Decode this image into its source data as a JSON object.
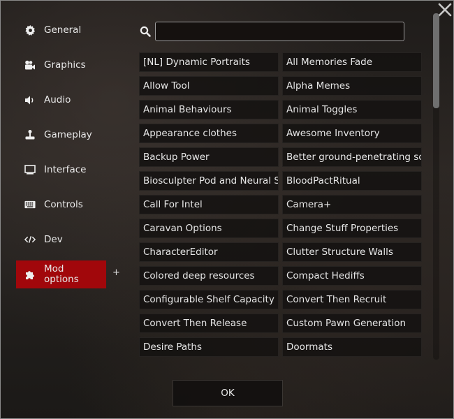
{
  "sidebar": {
    "items": [
      {
        "label": "General",
        "icon": "gear-icon"
      },
      {
        "label": "Graphics",
        "icon": "video-camera-icon"
      },
      {
        "label": "Audio",
        "icon": "speaker-icon"
      },
      {
        "label": "Gameplay",
        "icon": "joystick-icon"
      },
      {
        "label": "Interface",
        "icon": "monitor-icon"
      },
      {
        "label": "Controls",
        "icon": "keyboard-icon"
      },
      {
        "label": "Dev",
        "icon": "code-icon"
      },
      {
        "label": "Mod\noptions",
        "icon": "puzzle-icon",
        "active": true
      }
    ],
    "expand_label": "+"
  },
  "search": {
    "value": "",
    "placeholder": ""
  },
  "mods": [
    "[NL] Dynamic Portraits",
    "All Memories Fade",
    "Allow Tool",
    "Alpha Memes",
    "Animal Behaviours",
    "Animal Toggles",
    "Appearance clothes",
    "Awesome Inventory",
    "Backup Power",
    "Better ground-penetrating scanner",
    "Biosculpter Pod and Neural Supercharger",
    "BloodPactRitual",
    "Call For Intel",
    "Camera+",
    "Caravan Options",
    "Change Stuff Properties",
    "CharacterEditor",
    "Clutter Structure Walls",
    "Colored deep resources",
    "Compact Hediffs",
    "Configurable Shelf Capacity",
    "Convert Then Recruit",
    "Convert Then Release",
    "Custom Pawn Generation",
    "Desire Paths",
    "Doormats"
  ],
  "ok_label": "OK",
  "colors": {
    "active_tab": "#a1070b",
    "text": "#e6e6e6"
  }
}
